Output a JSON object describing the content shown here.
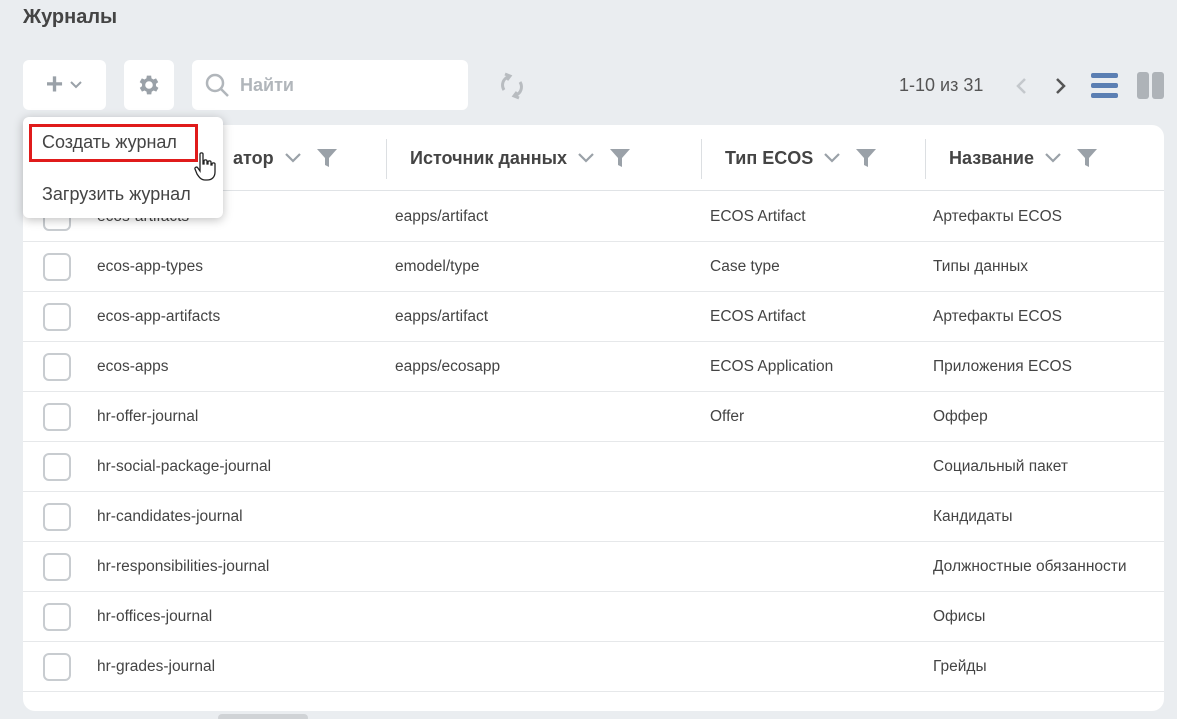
{
  "page": {
    "title": "Журналы"
  },
  "toolbar": {
    "add_icon": "plus-icon",
    "gear_icon": "gear-icon",
    "search_placeholder": "Найти",
    "search_value": "",
    "refresh_icon": "refresh-icon"
  },
  "pager": {
    "text": "1-10 из 31"
  },
  "dropdown": {
    "items": [
      {
        "label": "Создать журнал"
      },
      {
        "label": "Загрузить журнал"
      }
    ]
  },
  "table": {
    "columns": [
      {
        "label": "атор"
      },
      {
        "label": "Источник данных"
      },
      {
        "label": "Тип ECOS"
      },
      {
        "label": "Название"
      }
    ],
    "rows": [
      {
        "id": "ecos-artifacts",
        "source": "eapps/artifact",
        "type": "ECOS Artifact",
        "name": "Артефакты ECOS"
      },
      {
        "id": "ecos-app-types",
        "source": "emodel/type",
        "type": "Case type",
        "name": "Типы данных"
      },
      {
        "id": "ecos-app-artifacts",
        "source": "eapps/artifact",
        "type": "ECOS Artifact",
        "name": "Артефакты ECOS"
      },
      {
        "id": "ecos-apps",
        "source": "eapps/ecosapp",
        "type": "ECOS Application",
        "name": "Приложения ECOS"
      },
      {
        "id": "hr-offer-journal",
        "source": "",
        "type": "Offer",
        "name": "Оффер"
      },
      {
        "id": "hr-social-package-journal",
        "source": "",
        "type": "",
        "name": "Социальный пакет"
      },
      {
        "id": "hr-candidates-journal",
        "source": "",
        "type": "",
        "name": "Кандидаты"
      },
      {
        "id": "hr-responsibilities-journal",
        "source": "",
        "type": "",
        "name": "Должностные обязанности"
      },
      {
        "id": "hr-offices-journal",
        "source": "",
        "type": "",
        "name": "Офисы"
      },
      {
        "id": "hr-grades-journal",
        "source": "",
        "type": "",
        "name": "Грейды"
      }
    ]
  },
  "colors": {
    "accent": "#5b7fb3",
    "highlight": "#e01b1b",
    "icon_gray": "#9aa1a8"
  }
}
